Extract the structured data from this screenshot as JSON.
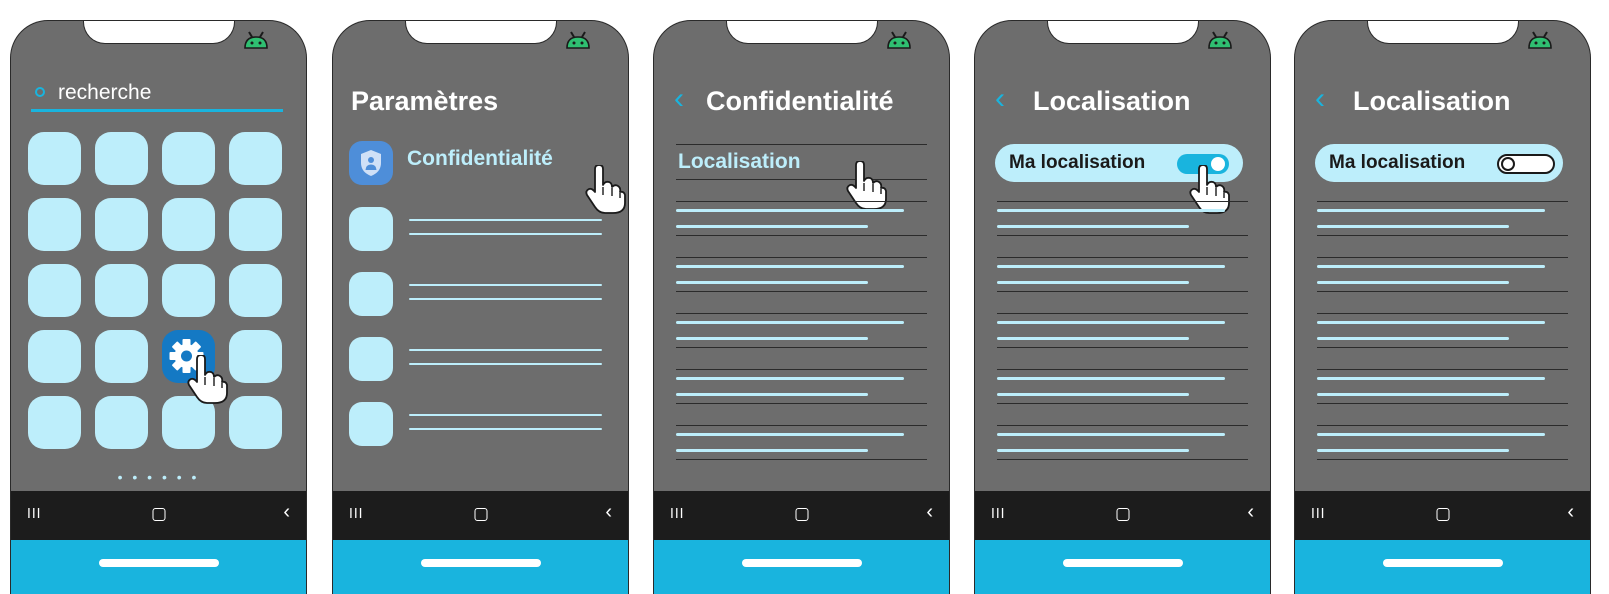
{
  "screen1": {
    "search": {
      "placeholder": "recherche"
    },
    "tiles": 20,
    "page_dots": "• • • • • •"
  },
  "screen2": {
    "title": "Paramètres",
    "privacy_item": {
      "label": "Confidentialité"
    },
    "other_items": 4
  },
  "screen3": {
    "title": "Confidentialité",
    "back_icon": "‹",
    "location_item": {
      "label": "Localisation"
    }
  },
  "screen4": {
    "title": "Localisation",
    "back_icon": "‹",
    "toggle": {
      "label": "Ma localisation",
      "state": "on"
    }
  },
  "screen5": {
    "title": "Localisation",
    "back_icon": "‹",
    "toggle": {
      "label": "Ma localisation",
      "state": "off"
    }
  },
  "navbar": {
    "recent": "III",
    "back": "‹"
  },
  "colors": {
    "screen_bg": "#6d6d6d",
    "accent": "#19b4de",
    "tile": "#bdeefb",
    "settings_tile": "#1479c4",
    "navbar": "#1c1c1c"
  },
  "icons": [
    "android-icon",
    "search-icon",
    "gear-icon",
    "shield-icon",
    "pointing-hand-icon",
    "recent-apps-icon",
    "home-icon",
    "back-icon"
  ]
}
